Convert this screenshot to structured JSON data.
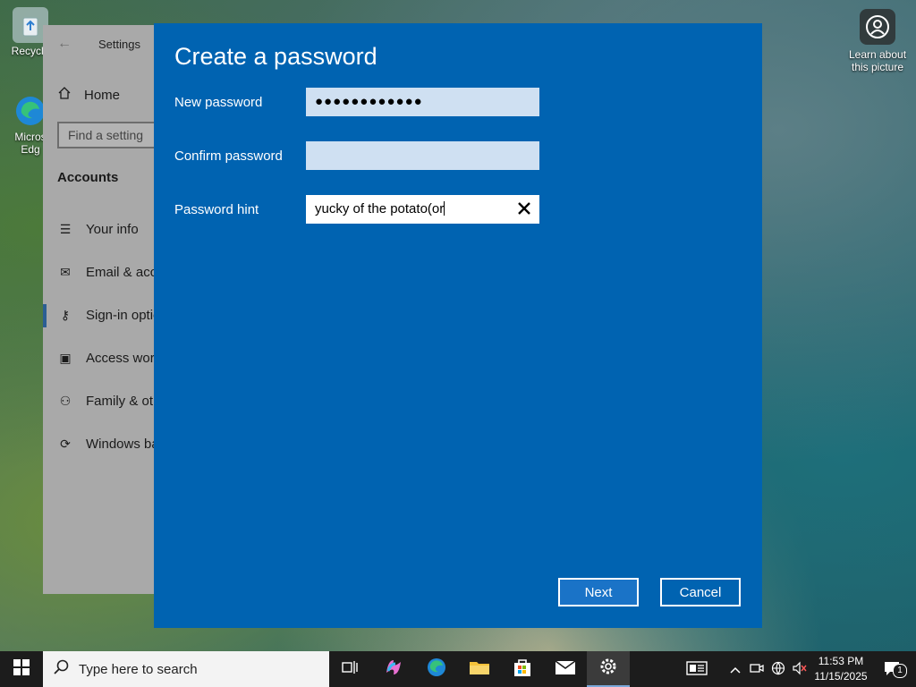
{
  "desktop": {
    "recycle_bin_label": "Recycle",
    "edge_label_line1": "Micros",
    "edge_label_line2": "Edg",
    "learn_label_line1": "Learn about",
    "learn_label_line2": "this picture"
  },
  "settings": {
    "title": "Settings",
    "home": "Home",
    "search_placeholder": "Find a setting",
    "section": "Accounts",
    "nav": [
      {
        "label": "Your info",
        "icon": "person-card-icon"
      },
      {
        "label": "Email & acco",
        "icon": "mail-icon"
      },
      {
        "label": "Sign-in optio",
        "icon": "key-icon"
      },
      {
        "label": "Access work",
        "icon": "briefcase-icon"
      },
      {
        "label": "Family & oth",
        "icon": "people-icon"
      },
      {
        "label": "Windows ba",
        "icon": "sync-icon"
      }
    ]
  },
  "dialog": {
    "title": "Create a password",
    "new_password_label": "New password",
    "new_password_value": "●●●●●●●●●●●●",
    "confirm_password_label": "Confirm password",
    "confirm_password_value": "",
    "hint_label": "Password hint",
    "hint_value": "yucky of the potato(or",
    "next_label": "Next",
    "cancel_label": "Cancel"
  },
  "taskbar": {
    "search_placeholder": "Type here to search",
    "time": "11:53 PM",
    "date": "11/15/2025",
    "notification_count": "1",
    "colors": {
      "background": "#1c1c1c",
      "dialog": "#0063b1"
    }
  }
}
